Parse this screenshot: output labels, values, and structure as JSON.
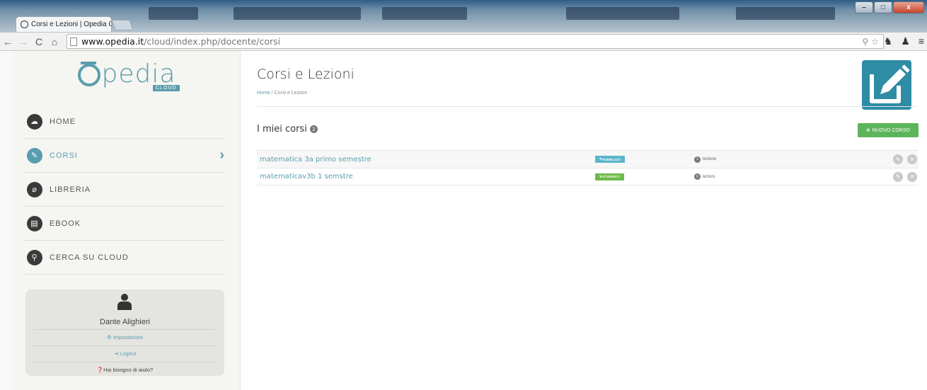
{
  "browser": {
    "tab_title": "Corsi e Lezioni | Opedia Cl",
    "tab_close": "×",
    "url_host": "www.opedia.it",
    "url_path": "/cloud/index.php/docente/corsi",
    "window_minimize": "–",
    "window_maximize": "□",
    "window_close": "x"
  },
  "sidebar": {
    "logo_text": "pedia",
    "logo_badge": "CLOUD",
    "menu": [
      {
        "label": "HOME",
        "icon": "cloud-icon"
      },
      {
        "label": "CORSI",
        "icon": "edit-icon",
        "active": true
      },
      {
        "label": "LIBRERIA",
        "icon": "paperclip-icon"
      },
      {
        "label": "EBOOK",
        "icon": "book-icon"
      },
      {
        "label": "CERCA SU CLOUD",
        "icon": "search-icon"
      }
    ],
    "user": {
      "name": "Dante Alighieri",
      "settings": "Impostazioni",
      "logout": "Logout",
      "help": "Hai bisogno di aiuto?"
    }
  },
  "main": {
    "title": "Corsi e Lezioni",
    "breadcrumb_home": "Home",
    "breadcrumb_sep": "/",
    "breadcrumb_current": "Corsi e Lezioni",
    "section_title": "I miei corsi",
    "section_count": "2",
    "new_course_label": "NUOVO CORSO",
    "courses": [
      {
        "name": "matematica 3a primo semestre",
        "badge": "PUBBLICO",
        "badge_color": "#5bb7cc",
        "lesson_count": "1",
        "lesson_label": "lezione"
      },
      {
        "name": "matematicav3b 1 semstre",
        "badge": "STUDENTI",
        "badge_color": "#6dbb4b",
        "lesson_count": "0",
        "lesson_label": "lezioni"
      }
    ]
  },
  "colors": {
    "accent": "#5a9dae",
    "green": "#5db55b",
    "hero_icon": "#2e8ca5"
  }
}
